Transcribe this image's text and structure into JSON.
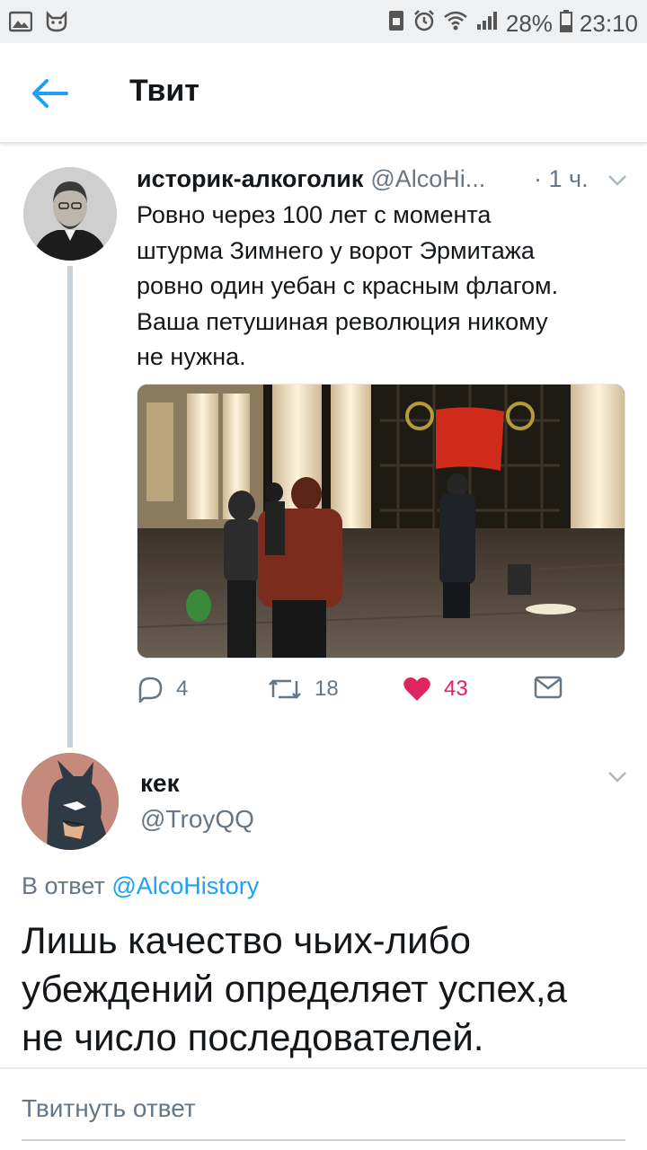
{
  "status_bar": {
    "battery": "28%",
    "time": "23:10",
    "icons": [
      "image-icon",
      "cat-icon",
      "sim-icon",
      "alarm-icon",
      "wifi-icon",
      "signal-icon",
      "battery-icon"
    ]
  },
  "header": {
    "title": "Твит",
    "back_icon": "arrow-left-icon"
  },
  "tweet": {
    "name": "историк-алкоголик",
    "handle": "@AlcoHi...",
    "time": "· 1 ч.",
    "text_lines": [
      "Ровно через 100 лет с момента",
      "штурма Зимнего у ворот Эрмитажа",
      "ровно один уебан с красным флагом.",
      "Ваша петушиная революция никому",
      "не нужна."
    ],
    "actions": {
      "replies": "4",
      "retweets": "18",
      "likes": "43"
    }
  },
  "reply": {
    "name": "кек",
    "handle": "@TroyQQ",
    "in_reply_prefix": "В ответ",
    "in_reply_mention": "@AlcoHistory",
    "text_lines": [
      "Лишь качество чьих-либо",
      "убеждений определяет успех,а",
      "не число последователей."
    ]
  },
  "compose": {
    "placeholder": "Твитнуть ответ"
  },
  "colors": {
    "accent": "#1da1f2",
    "like": "#e0245e",
    "secondary_text": "#657786"
  }
}
